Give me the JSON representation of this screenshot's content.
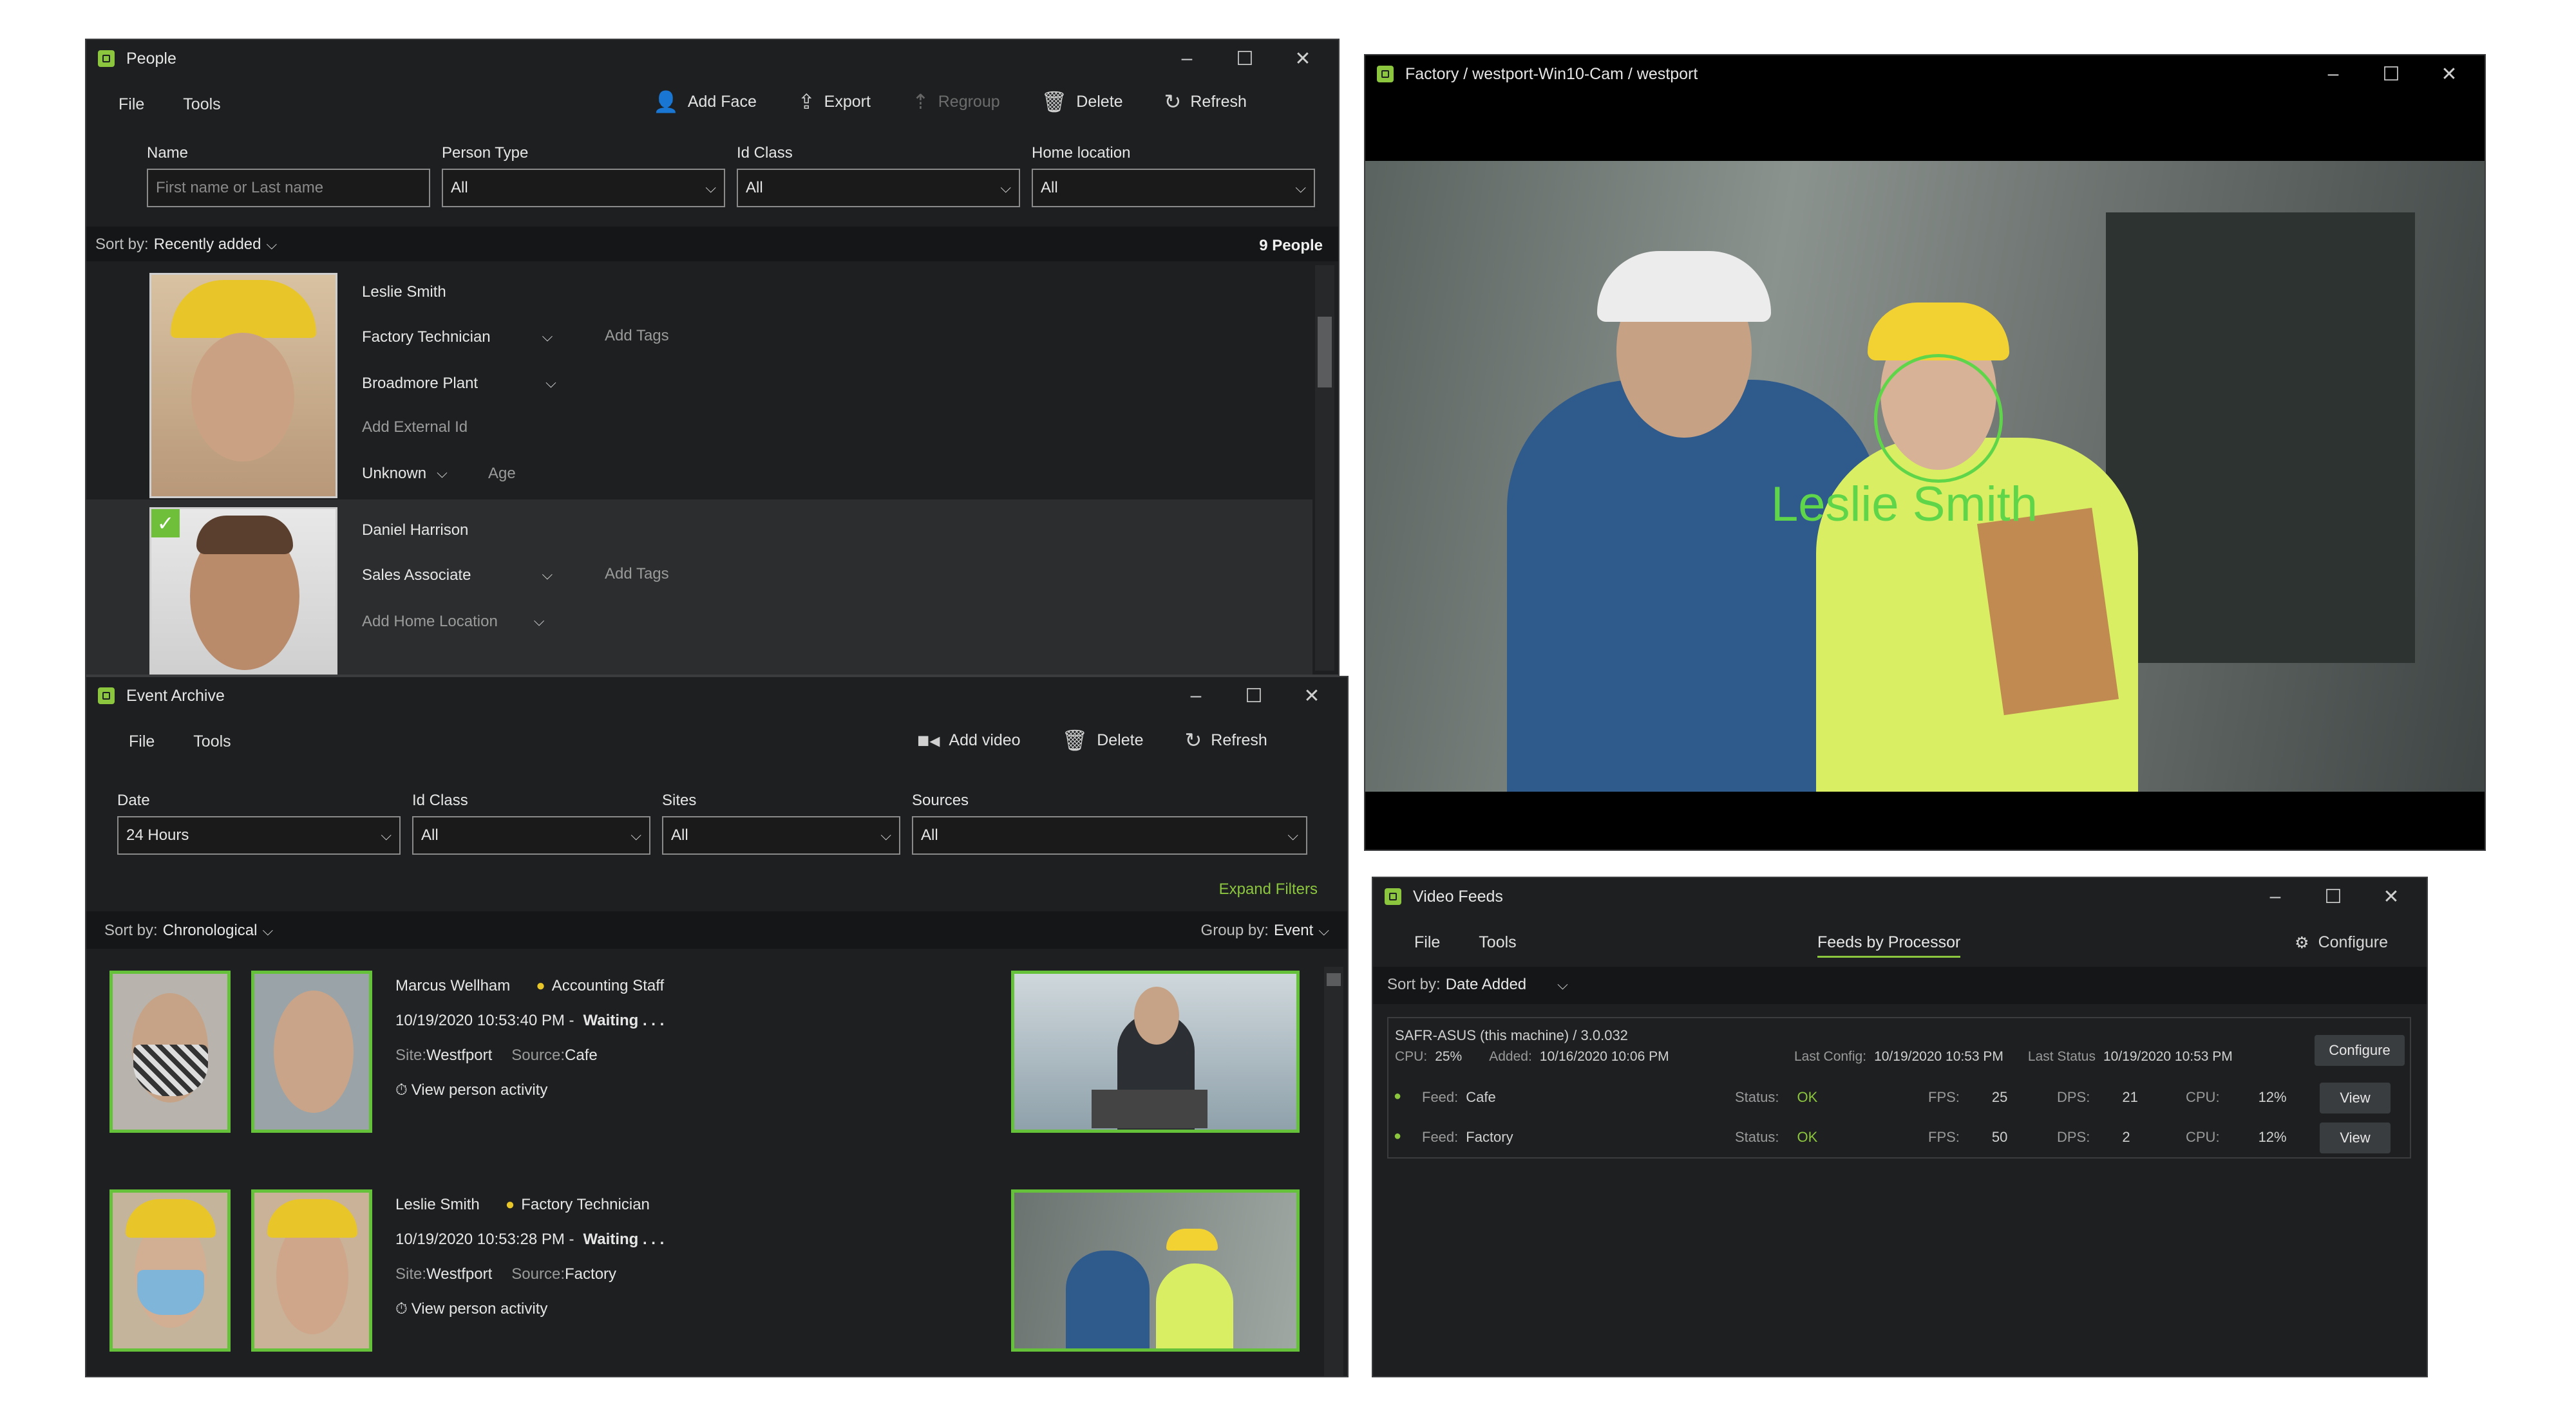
{
  "people": {
    "title": "People",
    "menu": [
      "File",
      "Tools"
    ],
    "toolbar": {
      "add_face": "Add Face",
      "export": "Export",
      "regroup": "Regroup",
      "delete": "Delete",
      "refresh": "Refresh"
    },
    "filters": {
      "name_label": "Name",
      "name_placeholder": "First name or Last name",
      "person_type_label": "Person Type",
      "person_type_value": "All",
      "id_class_label": "Id Class",
      "id_class_value": "All",
      "home_location_label": "Home location",
      "home_location_value": "All"
    },
    "sort_label": "Sort by:",
    "sort_value": "Recently added",
    "count": "9 People",
    "items": [
      {
        "name": "Leslie Smith",
        "type": "Factory Technician",
        "add_tags": "Add Tags",
        "location": "Broadmore Plant",
        "external_id": "Add External Id",
        "gender": "Unknown",
        "age": "Age"
      },
      {
        "name": "Daniel Harrison",
        "type": "Sales Associate",
        "add_tags": "Add Tags",
        "location": "Add Home Location"
      }
    ]
  },
  "camera": {
    "title": "Factory / westport-Win10-Cam / westport",
    "overlay_name": "Leslie Smith"
  },
  "events": {
    "title": "Event Archive",
    "menu": [
      "File",
      "Tools"
    ],
    "toolbar": {
      "add_video": "Add video",
      "delete": "Delete",
      "refresh": "Refresh"
    },
    "filters": {
      "date_label": "Date",
      "date_value": "24 Hours",
      "id_class_label": "Id Class",
      "id_class_value": "All",
      "sites_label": "Sites",
      "sites_value": "All",
      "sources_label": "Sources",
      "sources_value": "All"
    },
    "expand_filters": "Expand Filters",
    "sort_label": "Sort by:",
    "sort_value": "Chronological",
    "group_label": "Group by:",
    "group_value": "Event",
    "items": [
      {
        "name": "Marcus Wellham",
        "role": "Accounting Staff",
        "time": "10/19/2020 10:53:40 PM -",
        "status": "Waiting . . .",
        "site_label": "Site:",
        "site": "Westfport",
        "source_label": "Source:",
        "source": "Cafe",
        "activity": "View person activity"
      },
      {
        "name": "Leslie Smith",
        "role": "Factory Technician",
        "time": "10/19/2020 10:53:28 PM -",
        "status": "Waiting . . .",
        "site_label": "Site:",
        "site": "Westfport",
        "source_label": "Source:",
        "source": "Factory",
        "activity": "View person activity"
      }
    ]
  },
  "feeds": {
    "title": "Video Feeds",
    "menu": [
      "File",
      "Tools"
    ],
    "tab": "Feeds by Processor",
    "configure": "Configure",
    "sort_label": "Sort by:",
    "sort_value": "Date Added",
    "processor": {
      "name": "SAFR-ASUS (this machine) / 3.0.032",
      "cpu_label": "CPU:",
      "cpu": "25%",
      "added_label": "Added:",
      "added": "10/16/2020 10:06 PM",
      "last_config_label": "Last Config:",
      "last_config": "10/19/2020 10:53 PM",
      "last_status_label": "Last Status",
      "last_status": "10/19/2020 10:53 PM",
      "configure_btn": "Configure"
    },
    "rows": [
      {
        "feed_label": "Feed:",
        "feed": "Cafe",
        "status_label": "Status:",
        "status": "OK",
        "fps_label": "FPS:",
        "fps": "25",
        "dps_label": "DPS:",
        "dps": "21",
        "cpu_label": "CPU:",
        "cpu": "12%",
        "view": "View"
      },
      {
        "feed_label": "Feed:",
        "feed": "Factory",
        "status_label": "Status:",
        "status": "OK",
        "fps_label": "FPS:",
        "fps": "50",
        "dps_label": "DPS:",
        "dps": "2",
        "cpu_label": "CPU:",
        "cpu": "12%",
        "view": "View"
      }
    ]
  },
  "colors": {
    "accent": "#8cc63f",
    "window_bg": "#1d1f20",
    "thumb_border": "#66c13a"
  }
}
